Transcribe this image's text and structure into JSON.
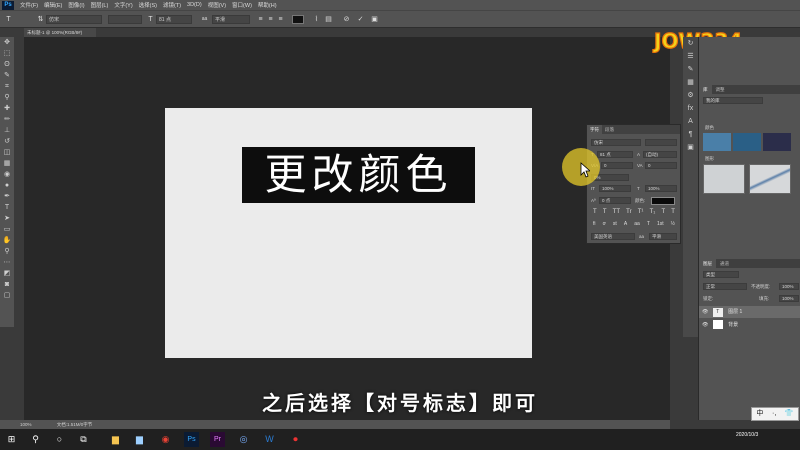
{
  "menubar": {
    "app_logo": "Ps",
    "items": [
      "文件(F)",
      "编辑(E)",
      "图像(I)",
      "图层(L)",
      "文字(Y)",
      "选择(S)",
      "滤镜(T)",
      "3D(D)",
      "视图(V)",
      "窗口(W)",
      "帮助(H)"
    ]
  },
  "options": {
    "font_family": "仿宋",
    "font_size": "81 点",
    "antialias": "平滑"
  },
  "tab": {
    "title": "未标题-1 @ 100%(RGB/8#)"
  },
  "canvas": {
    "layer_text": "更改颜色"
  },
  "subtitle": "之后选择【对号标志】即可",
  "character_panel": {
    "tabs": [
      "字符",
      "段落"
    ],
    "font_family": "仿宋",
    "font_size": "81 点",
    "leading": "(自动)",
    "kerning": "0",
    "tracking_value": "0",
    "scale_v": "100%",
    "scale_h": "100%",
    "baseline": "0 点",
    "color_label": "颜色:",
    "language": "美国英语",
    "aa": "平滑",
    "style_buttons": [
      "T",
      "T",
      "TT",
      "Tr",
      "T¹",
      "T₁",
      "T",
      "T"
    ],
    "ot_buttons": [
      "fi",
      "ơ",
      "st",
      "A",
      "aa",
      "T",
      "1st",
      "½"
    ]
  },
  "right_panels": {
    "lib_tabs": [
      "库",
      "调整"
    ],
    "lib_dropdown": "我的库",
    "lib_colors_label": "颜色",
    "lib_swatches": [
      "#4a7fa8",
      "#2a5f86",
      "#2b2d4a"
    ],
    "lib_graphics_label": "图形",
    "layers_tabs": [
      "图层",
      "通道"
    ],
    "kind": "类型",
    "blend": "正常",
    "opacity_label": "不透明度:",
    "opacity": "100%",
    "lock_label": "锁定:",
    "fill_label": "填充:",
    "fill": "100%",
    "layers": [
      {
        "name": "图层 1",
        "thumb": "T"
      },
      {
        "name": "背景",
        "thumb": ""
      }
    ]
  },
  "status": {
    "zoom": "100%",
    "doc": "文档:1.51M/0字节"
  },
  "taskbar": {
    "time": "2020/10/3"
  },
  "ime": {
    "items": [
      "中",
      "·,",
      "👕"
    ]
  },
  "brand": {
    "text": "JOW234"
  }
}
